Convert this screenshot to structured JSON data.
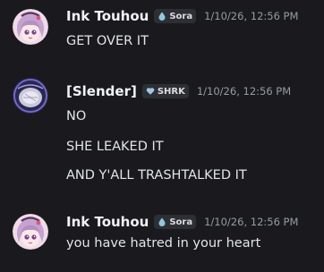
{
  "messages": [
    {
      "author": "Ink Touhou",
      "tag": "Sora",
      "timestamp": "1/10/26, 12:56 PM",
      "lines": [
        "GET OVER IT"
      ]
    },
    {
      "author": "[Slender]",
      "tag": "SHRK",
      "timestamp": "1/10/26, 12:56 PM",
      "lines": [
        "NO",
        "SHE LEAKED IT",
        "AND Y'ALL TRASHTALKED IT"
      ]
    },
    {
      "author": "Ink Touhou",
      "tag": "Sora",
      "timestamp": "1/10/26, 12:56 PM",
      "lines": [
        "you have hatred in your heart"
      ]
    }
  ],
  "colors": {
    "background": "#1a1a1e",
    "username": "#f2f3f5",
    "timestamp": "#949ba4",
    "text": "#e3e5e8"
  }
}
